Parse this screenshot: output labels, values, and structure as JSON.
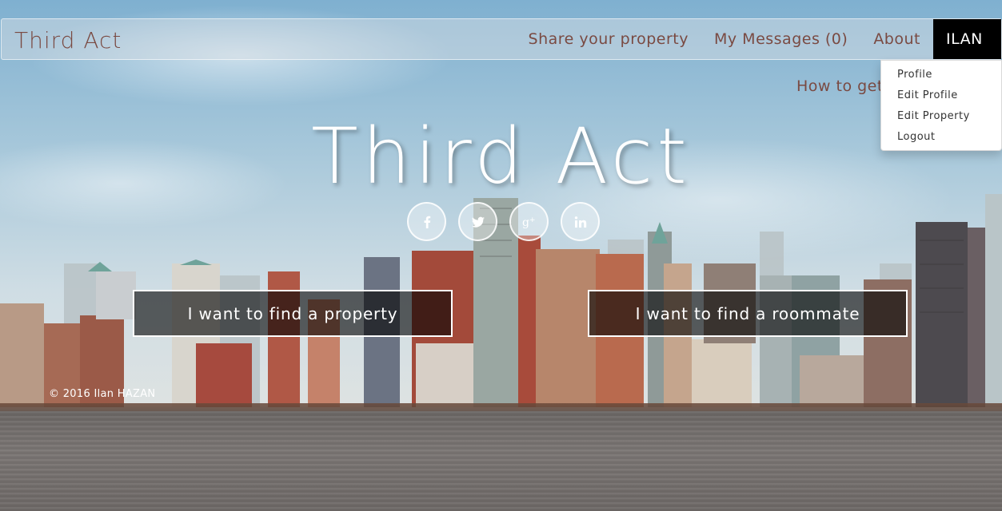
{
  "navbar": {
    "brand": "Third Act",
    "links": {
      "share": "Share your property",
      "messages": "My Messages (0)",
      "about": "About"
    },
    "user": "ILAN"
  },
  "dropdown": {
    "items": [
      "Profile",
      "Edit Profile",
      "Edit Property",
      "Logout"
    ]
  },
  "howto": "How to get",
  "hero": {
    "title": "Third Act",
    "social_icons": [
      "facebook-icon",
      "twitter-icon",
      "google-plus-icon",
      "linkedin-icon"
    ],
    "cta_property": "I want to find a property",
    "cta_roommate": "I want to find a roommate"
  },
  "footer": "© 2016 Ilan HAZAN",
  "colors": {
    "nav_text": "#7a4a42",
    "user_bg": "#000000"
  }
}
